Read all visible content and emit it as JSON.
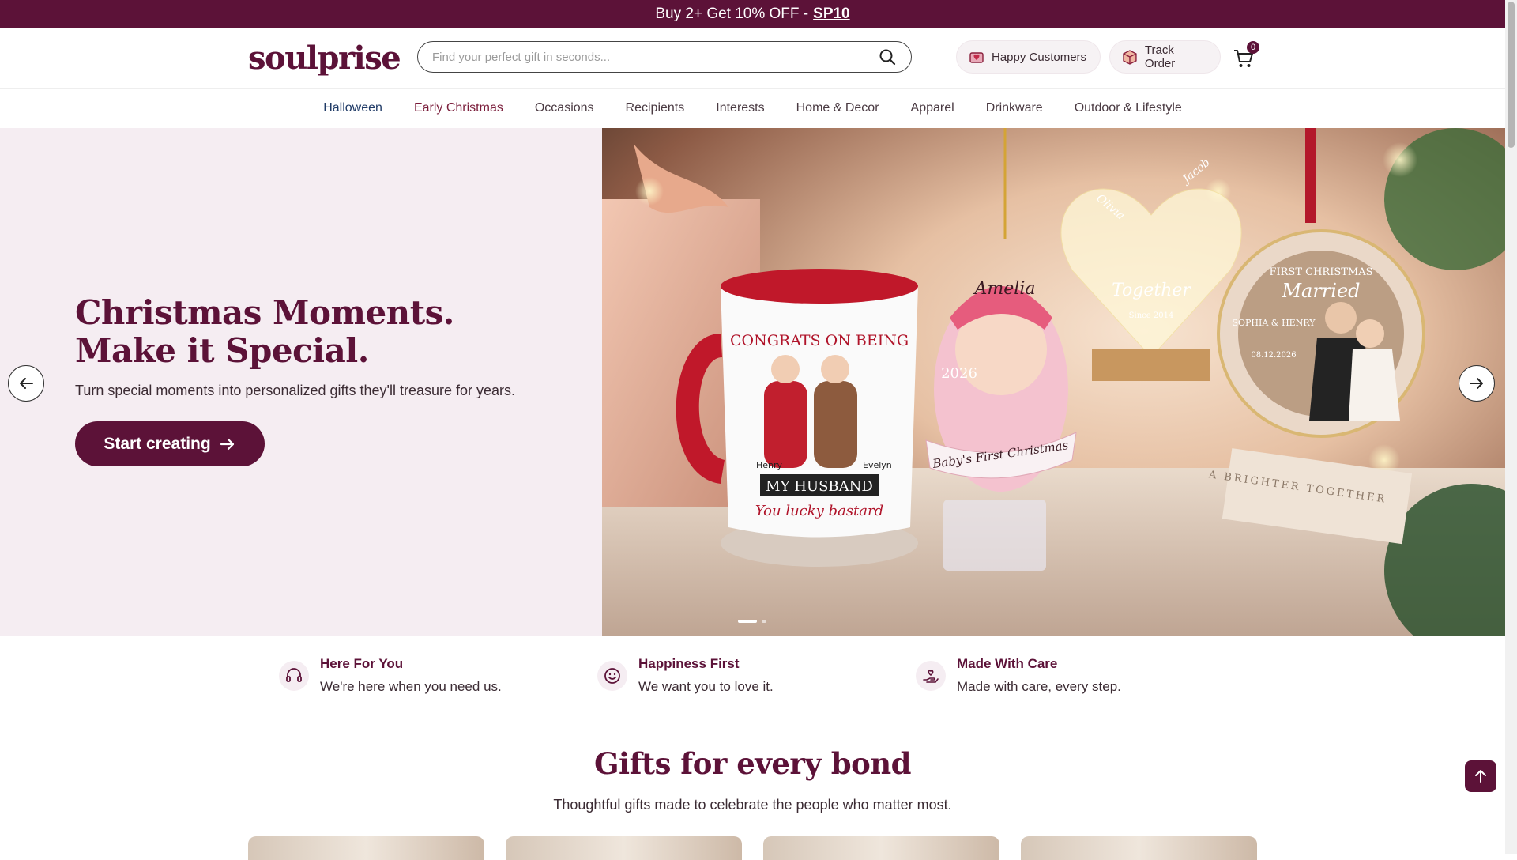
{
  "promo": {
    "text": "Buy 2+ Get 10% OFF -",
    "code": "SP10"
  },
  "header": {
    "logo": "soulprise",
    "search_placeholder": "Find your perfect gift in seconds...",
    "happy_customers": "Happy Customers",
    "track_order": "Track Order",
    "cart_count": "0"
  },
  "nav": {
    "items": [
      "Halloween",
      "Early Christmas",
      "Occasions",
      "Recipients",
      "Interests",
      "Home & Decor",
      "Apparel",
      "Drinkware",
      "Outdoor & Lifestyle"
    ]
  },
  "hero": {
    "title_line1": "Christmas Moments.",
    "title_line2": "Make it Special.",
    "subtitle": "Turn special moments into personalized gifts they'll treasure for years.",
    "cta": "Start creating",
    "slide_text": {
      "mug_top": "CONGRATS ON BEING",
      "mug_name_left": "Henry",
      "mug_name_right": "Evelyn",
      "mug_banner": "MY HUSBAND",
      "mug_bottom": "You lucky bastard",
      "baby_name": "Amelia",
      "baby_year": "2026",
      "baby_banner": "Baby's First Christmas",
      "heart_name1": "Olivia",
      "heart_name2": "Jacob",
      "heart_word": "Together",
      "heart_since": "Since 2014",
      "orn_top": "FIRST CHRISTMAS",
      "orn_script": "Married",
      "orn_names": "SOPHIA & HENRY",
      "orn_date": "08.12.2026",
      "box_text": "A BRIGHTER TOGETHER"
    }
  },
  "features": [
    {
      "title": "Here For You",
      "desc": "We're here when you need us."
    },
    {
      "title": "Happiness First",
      "desc": "We want you to love it."
    },
    {
      "title": "Made With Care",
      "desc": "Made with care, every step."
    }
  ],
  "section": {
    "title": "Gifts for every bond",
    "subtitle": "Thoughtful gifts made to celebrate the people who matter most."
  }
}
